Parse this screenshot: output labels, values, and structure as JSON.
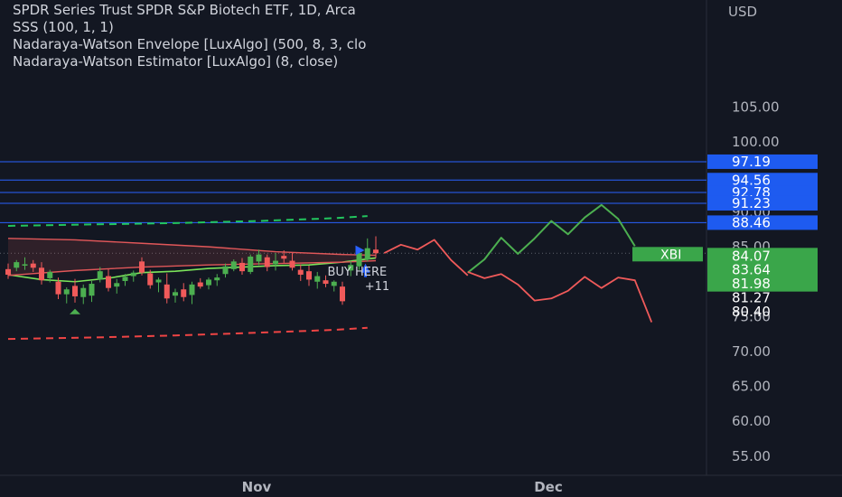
{
  "header": {
    "title": "SPDR Series Trust SPDR S&P Biotech ETF, 1D, Arca",
    "indicator_1": "SSS (100, 1, 1)",
    "indicator_2": "Nadaraya-Watson Envelope [LuxAlgo] (500, 8, 3, clo",
    "indicator_3": "Nadaraya-Watson Estimator [LuxAlgo] (8, close)",
    "currency": "USD"
  },
  "colors": {
    "background": "#131722",
    "bull": "#4caf50",
    "bear": "#f05a5a",
    "level_line": "#2962ff",
    "level_label": "#1e5bf0",
    "envelope_upper": "#22c55e",
    "envelope_lower": "#ef4444",
    "symbol_label": "#3aa64a"
  },
  "chart_data": {
    "type": "candlestick",
    "symbol": "XBI",
    "timeframe": "1D",
    "x_ticks": [
      "Nov",
      "Dec"
    ],
    "y_ticks": [
      105,
      100,
      90,
      85,
      75,
      70,
      65,
      60,
      55
    ],
    "y_tick_labels": [
      "105.00",
      "100.00",
      "90.00",
      "85.00",
      "75.00",
      "70.00",
      "65.00",
      "60.00",
      "55.00"
    ],
    "ylim": [
      53.3,
      112.2
    ],
    "last_price": 84.07,
    "price_levels": [
      {
        "value": 97.19,
        "label": "97.19"
      },
      {
        "value": 94.56,
        "label": "94.56"
      },
      {
        "value": 92.78,
        "label": "92.78"
      },
      {
        "value": 91.23,
        "label": "91.23"
      },
      {
        "value": 88.46,
        "label": "88.46"
      }
    ],
    "right_labels": [
      {
        "value": 84.07,
        "label": "84.07"
      },
      {
        "value": 83.64,
        "label": "83.64"
      },
      {
        "value": 81.98,
        "label": "81.98"
      },
      {
        "value": 81.27,
        "label": "81.27"
      },
      {
        "value": 80.4,
        "label": "80.40"
      }
    ],
    "symbol_label": "XBI",
    "annotation_main": "BUY HERE",
    "annotation_sub": "+11",
    "candles": [
      {
        "o": 81.8,
        "h": 82.6,
        "l": 80.4,
        "c": 81.0
      },
      {
        "o": 82.0,
        "h": 83.1,
        "l": 81.5,
        "c": 82.8
      },
      {
        "o": 82.3,
        "h": 83.5,
        "l": 81.7,
        "c": 82.5
      },
      {
        "o": 82.6,
        "h": 83.1,
        "l": 81.4,
        "c": 82.0
      },
      {
        "o": 82.0,
        "h": 82.8,
        "l": 79.6,
        "c": 80.2
      },
      {
        "o": 80.5,
        "h": 81.7,
        "l": 79.9,
        "c": 81.4
      },
      {
        "o": 80.0,
        "h": 80.6,
        "l": 77.5,
        "c": 78.2
      },
      {
        "o": 78.2,
        "h": 79.2,
        "l": 76.9,
        "c": 78.9
      },
      {
        "o": 79.4,
        "h": 80.4,
        "l": 77.0,
        "c": 77.9
      },
      {
        "o": 77.8,
        "h": 79.6,
        "l": 76.8,
        "c": 79.1
      },
      {
        "o": 78.0,
        "h": 80.1,
        "l": 77.1,
        "c": 79.7
      },
      {
        "o": 80.3,
        "h": 82.1,
        "l": 79.9,
        "c": 81.5
      },
      {
        "o": 80.8,
        "h": 81.8,
        "l": 78.6,
        "c": 79.1
      },
      {
        "o": 79.3,
        "h": 80.4,
        "l": 78.3,
        "c": 79.8
      },
      {
        "o": 80.1,
        "h": 81.1,
        "l": 79.4,
        "c": 80.7
      },
      {
        "o": 80.8,
        "h": 81.6,
        "l": 80.0,
        "c": 81.3
      },
      {
        "o": 82.9,
        "h": 83.5,
        "l": 80.9,
        "c": 81.3
      },
      {
        "o": 81.2,
        "h": 81.7,
        "l": 79.0,
        "c": 79.5
      },
      {
        "o": 79.9,
        "h": 80.6,
        "l": 78.5,
        "c": 80.3
      },
      {
        "o": 79.6,
        "h": 81.2,
        "l": 76.9,
        "c": 77.6
      },
      {
        "o": 78.0,
        "h": 79.0,
        "l": 77.0,
        "c": 78.5
      },
      {
        "o": 78.9,
        "h": 79.8,
        "l": 77.2,
        "c": 77.8
      },
      {
        "o": 78.1,
        "h": 80.0,
        "l": 76.8,
        "c": 79.6
      },
      {
        "o": 79.9,
        "h": 80.5,
        "l": 79.0,
        "c": 79.3
      },
      {
        "o": 79.5,
        "h": 80.6,
        "l": 78.9,
        "c": 80.3
      },
      {
        "o": 80.2,
        "h": 81.1,
        "l": 79.4,
        "c": 80.6
      },
      {
        "o": 81.1,
        "h": 82.6,
        "l": 80.6,
        "c": 82.2
      },
      {
        "o": 81.8,
        "h": 83.2,
        "l": 81.5,
        "c": 82.9
      },
      {
        "o": 82.7,
        "h": 83.4,
        "l": 81.0,
        "c": 81.5
      },
      {
        "o": 81.4,
        "h": 83.9,
        "l": 81.1,
        "c": 83.6
      },
      {
        "o": 82.9,
        "h": 84.6,
        "l": 82.4,
        "c": 83.9
      },
      {
        "o": 83.5,
        "h": 83.9,
        "l": 81.5,
        "c": 82.1
      },
      {
        "o": 82.5,
        "h": 84.1,
        "l": 81.6,
        "c": 83.0
      },
      {
        "o": 83.7,
        "h": 84.5,
        "l": 82.7,
        "c": 83.3
      },
      {
        "o": 83.0,
        "h": 84.1,
        "l": 81.6,
        "c": 82.0
      },
      {
        "o": 81.7,
        "h": 82.5,
        "l": 80.1,
        "c": 81.0
      },
      {
        "o": 81.5,
        "h": 82.3,
        "l": 79.4,
        "c": 80.3
      },
      {
        "o": 80.0,
        "h": 81.4,
        "l": 79.0,
        "c": 80.8
      },
      {
        "o": 80.2,
        "h": 80.9,
        "l": 79.2,
        "c": 79.7
      },
      {
        "o": 79.4,
        "h": 80.2,
        "l": 78.6,
        "c": 80.0
      },
      {
        "o": 79.3,
        "h": 80.0,
        "l": 76.7,
        "c": 77.2
      },
      {
        "o": 81.6,
        "h": 83.0,
        "l": 80.8,
        "c": 82.4
      },
      {
        "o": 82.2,
        "h": 84.5,
        "l": 81.7,
        "c": 84.1
      },
      {
        "o": 83.2,
        "h": 86.2,
        "l": 82.9,
        "c": 84.8
      },
      {
        "o": 84.6,
        "h": 86.5,
        "l": 83.4,
        "c": 84.07
      }
    ],
    "series": [
      {
        "name": "Nadaraya-Watson Envelope upper",
        "style": "dashed",
        "values": [
          [
            0,
            88.0
          ],
          [
            10,
            88.2
          ],
          [
            20,
            88.4
          ],
          [
            30,
            88.7
          ],
          [
            39,
            89.1
          ],
          [
            43,
            89.4
          ]
        ]
      },
      {
        "name": "Nadaraya-Watson Envelope lower",
        "style": "dashed",
        "values": [
          [
            0,
            71.8
          ],
          [
            10,
            72.0
          ],
          [
            20,
            72.3
          ],
          [
            30,
            72.7
          ],
          [
            39,
            73.1
          ],
          [
            43,
            73.4
          ]
        ]
      },
      {
        "name": "Nadaraya-Watson Estimator",
        "style": "solid",
        "values": [
          [
            0,
            81.0
          ],
          [
            4,
            80.3
          ],
          [
            8,
            80.0
          ],
          [
            12,
            80.5
          ],
          [
            16,
            81.3
          ],
          [
            20,
            81.5
          ],
          [
            24,
            81.9
          ],
          [
            28,
            82.1
          ],
          [
            32,
            82.3
          ],
          [
            36,
            82.4
          ],
          [
            40,
            82.8
          ],
          [
            44,
            83.4
          ]
        ]
      },
      {
        "name": "Moving average upper",
        "style": "solid",
        "values": [
          [
            0,
            86.2
          ],
          [
            8,
            86.0
          ],
          [
            16,
            85.5
          ],
          [
            24,
            85.0
          ],
          [
            32,
            84.3
          ],
          [
            40,
            83.9
          ],
          [
            44,
            83.8
          ]
        ]
      },
      {
        "name": "Moving average lower",
        "style": "solid",
        "values": [
          [
            0,
            80.9
          ],
          [
            8,
            81.6
          ],
          [
            16,
            82.1
          ],
          [
            24,
            82.4
          ],
          [
            32,
            82.6
          ],
          [
            40,
            82.8
          ],
          [
            44,
            83.0
          ]
        ]
      },
      {
        "name": "Projection (rising)",
        "style": "solid",
        "values": [
          [
            45,
            84.1
          ],
          [
            47,
            85.3
          ],
          [
            49,
            84.6
          ],
          [
            51,
            86.0
          ],
          [
            53,
            83.1
          ],
          [
            55,
            80.9
          ]
        ]
      },
      {
        "name": "Projection bullish",
        "style": "solid",
        "values": [
          [
            55,
            81.3
          ],
          [
            57,
            83.2
          ],
          [
            59,
            86.3
          ],
          [
            61,
            84.0
          ],
          [
            63,
            86.2
          ],
          [
            65,
            88.7
          ],
          [
            67,
            86.8
          ],
          [
            69,
            89.2
          ],
          [
            71,
            91.0
          ],
          [
            73,
            89.0
          ],
          [
            75,
            85.1
          ]
        ]
      },
      {
        "name": "Projection bearish",
        "style": "solid",
        "values": [
          [
            55,
            81.4
          ],
          [
            57,
            80.5
          ],
          [
            59,
            81.1
          ],
          [
            61,
            79.6
          ],
          [
            63,
            77.3
          ],
          [
            65,
            77.6
          ],
          [
            67,
            78.7
          ],
          [
            69,
            80.7
          ],
          [
            71,
            79.1
          ],
          [
            73,
            80.6
          ],
          [
            75,
            80.2
          ],
          [
            77,
            74.2
          ]
        ]
      }
    ],
    "grid": false
  }
}
